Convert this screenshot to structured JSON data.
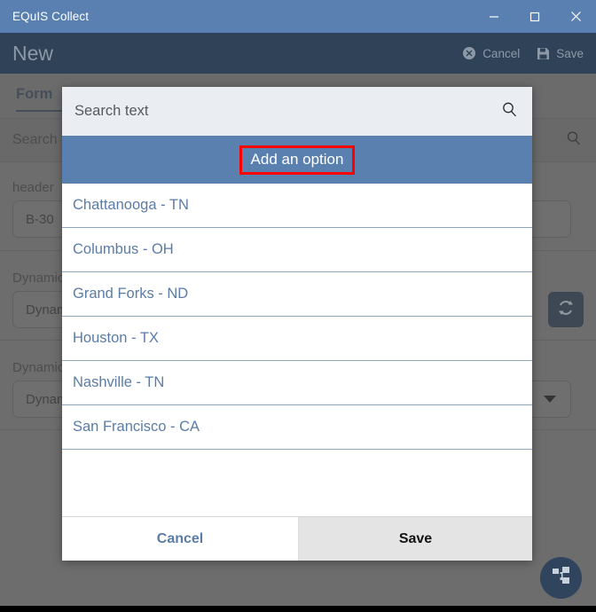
{
  "window": {
    "title": "EQuIS Collect",
    "minimize_label": "Minimize",
    "maximize_label": "Maximize",
    "close_label": "Close"
  },
  "app_header": {
    "title": "New",
    "cancel_label": "Cancel",
    "save_label": "Save"
  },
  "background": {
    "tab_label": "Form",
    "search_label": "Search",
    "fields": [
      {
        "label": "header",
        "value": "B-30"
      },
      {
        "label": "Dynamic",
        "value": "Dynamic"
      },
      {
        "label": "Dynamic",
        "value": "Dynamic"
      }
    ]
  },
  "dialog": {
    "search_placeholder": "Search text",
    "search_value": "",
    "add_option_label": "Add an option",
    "options": [
      "Chattanooga - TN",
      "Columbus - OH",
      "Grand Forks - ND",
      "Houston - TX",
      "Nashville - TN",
      "San Francisco - CA"
    ],
    "cancel_label": "Cancel",
    "save_label": "Save"
  },
  "colors": {
    "titlebar_blue": "#5980b0",
    "header_dark": "#2f4257",
    "highlight_blue": "#5a80b0",
    "link_blue": "#5a7ca6",
    "annotation_red": "#ff0000"
  }
}
